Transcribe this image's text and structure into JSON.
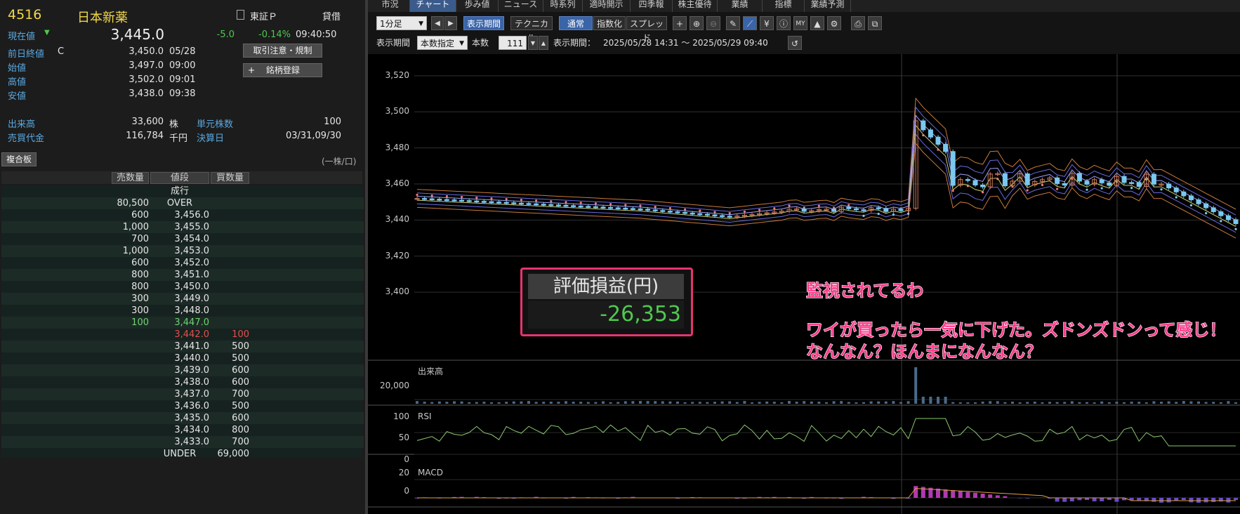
{
  "stock": {
    "code": "4516",
    "name": "日本新薬",
    "market": "東証Ｐ",
    "lending": "貸借",
    "current_label": "現在値",
    "current_value": "3,445.0",
    "change": "-5.0",
    "change_pct": "-0.14%",
    "current_time": "09:40:50"
  },
  "quote_rows": [
    {
      "label": "前日終値",
      "flag": "C",
      "value": "3,450.0",
      "time": "05/28"
    },
    {
      "label": "始値",
      "flag": "",
      "value": "3,497.0",
      "time": "09:00"
    },
    {
      "label": "高値",
      "flag": "",
      "value": "3,502.0",
      "time": "09:01"
    },
    {
      "label": "安値",
      "flag": "",
      "value": "3,438.0",
      "time": "09:38"
    }
  ],
  "volume": {
    "label": "出来高",
    "value": "33,600",
    "unit": "株"
  },
  "turnover": {
    "label": "売買代金",
    "value": "116,784",
    "unit": "千円"
  },
  "unit_shares": {
    "label": "単元株数",
    "value": "100"
  },
  "settlement": {
    "label": "決算日",
    "value": "03/31,09/30"
  },
  "buttons": {
    "restrictions": "取引注意・規制",
    "register": "銘柄登録",
    "register_icon": "+"
  },
  "board": {
    "tab": "複合板",
    "unit_note": "(一株/口)",
    "headers": {
      "sell": "売数量",
      "price": "値段",
      "buy": "買数量"
    },
    "rows": [
      {
        "sell": "",
        "price": "成行",
        "buy": "",
        "color": "#e6e6e6"
      },
      {
        "sell": "80,500",
        "price": "OVER",
        "buy": "",
        "color": "#e6e6e6"
      },
      {
        "sell": "600",
        "price": "3,456.0",
        "buy": "",
        "color": "#e6e6e6"
      },
      {
        "sell": "1,000",
        "price": "3,455.0",
        "buy": "",
        "color": "#e6e6e6"
      },
      {
        "sell": "700",
        "price": "3,454.0",
        "buy": "",
        "color": "#e6e6e6"
      },
      {
        "sell": "1,000",
        "price": "3,453.0",
        "buy": "",
        "color": "#e6e6e6"
      },
      {
        "sell": "600",
        "price": "3,452.0",
        "buy": "",
        "color": "#e6e6e6"
      },
      {
        "sell": "800",
        "price": "3,451.0",
        "buy": "",
        "color": "#e6e6e6"
      },
      {
        "sell": "800",
        "price": "3,450.0",
        "buy": "",
        "color": "#e6e6e6"
      },
      {
        "sell": "300",
        "price": "3,449.0",
        "buy": "",
        "color": "#e6e6e6"
      },
      {
        "sell": "300",
        "price": "3,448.0",
        "buy": "",
        "color": "#e6e6e6"
      },
      {
        "sell": "100",
        "price": "3,447.0",
        "buy": "",
        "color": "#6ed46e"
      },
      {
        "sell": "",
        "price": "3,442.0",
        "buy": "100",
        "color": "#e05050"
      },
      {
        "sell": "",
        "price": "3,441.0",
        "buy": "500",
        "color": "#e6e6e6"
      },
      {
        "sell": "",
        "price": "3,440.0",
        "buy": "500",
        "color": "#e6e6e6"
      },
      {
        "sell": "",
        "price": "3,439.0",
        "buy": "600",
        "color": "#e6e6e6"
      },
      {
        "sell": "",
        "price": "3,438.0",
        "buy": "600",
        "color": "#e6e6e6"
      },
      {
        "sell": "",
        "price": "3,437.0",
        "buy": "700",
        "color": "#e6e6e6"
      },
      {
        "sell": "",
        "price": "3,436.0",
        "buy": "500",
        "color": "#e6e6e6"
      },
      {
        "sell": "",
        "price": "3,435.0",
        "buy": "600",
        "color": "#e6e6e6"
      },
      {
        "sell": "",
        "price": "3,434.0",
        "buy": "800",
        "color": "#e6e6e6"
      },
      {
        "sell": "",
        "price": "3,433.0",
        "buy": "700",
        "color": "#e6e6e6"
      },
      {
        "sell": "",
        "price": "UNDER",
        "buy": "69,000",
        "color": "#e6e6e6"
      }
    ]
  },
  "tabs": [
    "市況",
    "チャート",
    "歩み値",
    "ニュース",
    "時系列",
    "適時開示",
    "四季報",
    "株主優待",
    "業績",
    "指標",
    "業績予測"
  ],
  "active_tab": "チャート",
  "toolbar": {
    "interval": "1分足",
    "display_period_btn": "表示期間",
    "technical_btn": "テクニカル",
    "normal_btn": "通常",
    "index_btn": "指数化",
    "spread_btn": "スプレッド",
    "period_label": "表示期間",
    "period_mode": "本数指定",
    "count_label": "本数",
    "count_value": "111",
    "range_label": "表示期間：",
    "range_value": "2025/05/28 14:31 ～ 2025/05/29 09:40"
  },
  "chart_data": {
    "type": "candlestick",
    "ylim": [
      3395,
      3525
    ],
    "price_ticks": [
      "3,520",
      "3,500",
      "3,480",
      "3,460",
      "3,440",
      "3,420",
      "3,400"
    ],
    "volume_label": "出来高",
    "volume_ticks": [
      "20,000"
    ],
    "rsi_label": "RSI",
    "rsi_ticks": [
      "100",
      "50",
      "0"
    ],
    "macd_label": "MACD",
    "macd_ticks": [
      "20",
      "0"
    ]
  },
  "pnl_box": {
    "title": "評価損益(円)",
    "value": "-26,353"
  },
  "annotations": {
    "line1": "監視されてるわ",
    "line2": "ワイが買ったら一気に下げた。ズドンズドンって感じ！",
    "line3": "なんなん？ほんまになんなん？"
  },
  "colors": {
    "accent_blue": "#3a64a8",
    "annotation_pink": "#ff3d8b",
    "loss_green": "#4ec94e",
    "arrow_red": "#e8262c",
    "arrow_blue": "#1aa0e6"
  }
}
